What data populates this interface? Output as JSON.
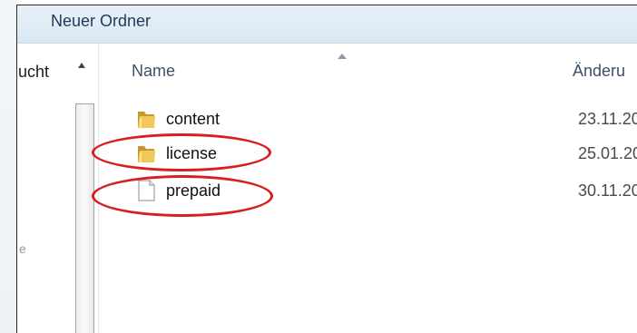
{
  "window": {
    "breadcrumb": "Neuer Ordner"
  },
  "nav": {
    "item_label": "ucht",
    "side_mark": "e"
  },
  "columns": {
    "name": "Name",
    "date": "Änderu"
  },
  "files": [
    {
      "name": "content",
      "date": "23.11.20",
      "icon": "folder-icon"
    },
    {
      "name": "license",
      "date": "25.01.20",
      "icon": "folder-icon"
    },
    {
      "name": "prepaid",
      "date": "30.11.20",
      "icon": "file-icon"
    }
  ],
  "colors": {
    "highlight": "#d62020",
    "folder": "#e3b341"
  }
}
